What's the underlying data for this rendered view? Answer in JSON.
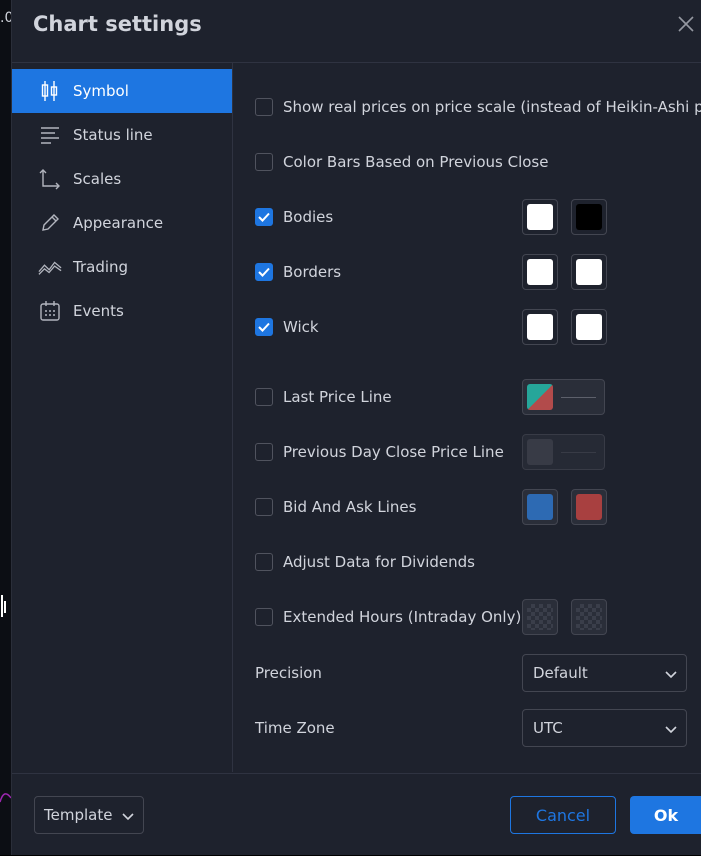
{
  "background": {
    "fragment_text": ".0"
  },
  "dialog": {
    "title": "Chart settings"
  },
  "sidebar": {
    "items": [
      {
        "label": "Symbol",
        "icon": "candlestick-icon",
        "active": true
      },
      {
        "label": "Status line",
        "icon": "lines-icon",
        "active": false
      },
      {
        "label": "Scales",
        "icon": "axes-icon",
        "active": false
      },
      {
        "label": "Appearance",
        "icon": "pencil-icon",
        "active": false
      },
      {
        "label": "Trading",
        "icon": "trading-icon",
        "active": false
      },
      {
        "label": "Events",
        "icon": "calendar-icon",
        "active": false
      }
    ]
  },
  "symbol": {
    "show_real_prices": {
      "label": "Show real prices on price scale (instead of Heikin-Ashi price)",
      "checked": false
    },
    "color_bars": {
      "label": "Color Bars Based on Previous Close",
      "checked": false
    },
    "bodies": {
      "label": "Bodies",
      "checked": true,
      "colors": [
        "#ffffff",
        "#000000"
      ]
    },
    "borders": {
      "label": "Borders",
      "checked": true,
      "colors": [
        "#ffffff",
        "#ffffff"
      ]
    },
    "wick": {
      "label": "Wick",
      "checked": true,
      "colors": [
        "#ffffff",
        "#ffffff"
      ]
    },
    "last_price_line": {
      "label": "Last Price Line",
      "checked": false,
      "colors": [
        "#26a69a",
        "#b24b4b"
      ]
    },
    "prev_day_close": {
      "label": "Previous Day Close Price Line",
      "checked": false,
      "color": "#434651"
    },
    "bid_ask": {
      "label": "Bid And Ask Lines",
      "checked": false,
      "colors": [
        "#2d6ab3",
        "#a84040"
      ]
    },
    "adjust_dividends": {
      "label": "Adjust Data for Dividends",
      "checked": false
    },
    "extended_hours": {
      "label": "Extended Hours (Intraday Only)",
      "checked": false
    },
    "precision": {
      "label": "Precision",
      "value": "Default"
    },
    "timezone": {
      "label": "Time Zone",
      "value": "UTC"
    }
  },
  "footer": {
    "template_label": "Template",
    "cancel_label": "Cancel",
    "ok_label": "Ok"
  },
  "colors": {
    "accent": "#1e76e1",
    "dialog_bg": "#1e222d"
  }
}
